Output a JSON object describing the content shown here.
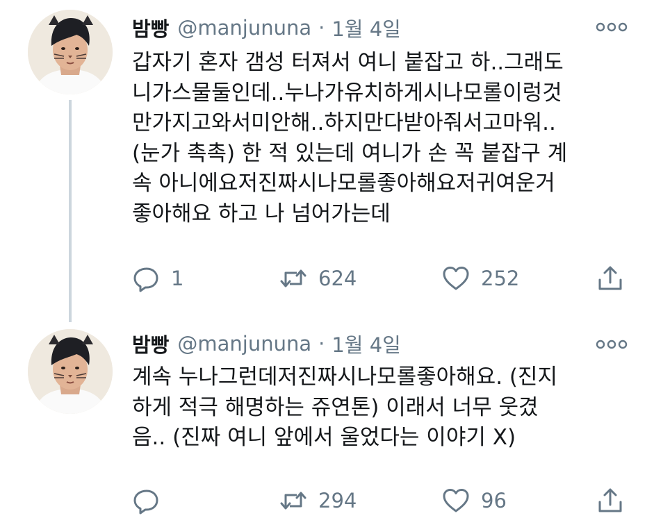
{
  "tweets": [
    {
      "display_name": "밤빵",
      "handle": "@manjununa",
      "separator": "·",
      "date": "1월 4일",
      "lines": [
        "갑자기 혼자 갬성 터져서 여니 붙잡고 하..그래도",
        "니가스물둘인데..누나가유치하게시나모롤이렁것",
        "만가지고와서미안해..하지만다받아줘서고마워..",
        "(눈가 촉촉) 한 적 있는데 여니가 손 꼭 붙잡구 계",
        "속 아니에요저진짜시나모롤좋아해요저귀여운거",
        "좋아해요 하고 나 넘어가는데"
      ],
      "reply_count": "1",
      "retweet_count": "624",
      "like_count": "252",
      "icons": {
        "avatar": "avatar-image",
        "more": "more-dots-icon",
        "reply": "reply-bubble-icon",
        "retweet": "retweet-icon",
        "like": "heart-icon",
        "share": "share-icon"
      }
    },
    {
      "display_name": "밤빵",
      "handle": "@manjununa",
      "separator": "·",
      "date": "1월 4일",
      "lines": [
        "계속 누나그런데저진짜시나모롤좋아해요. (진지",
        "하게 적극 해명하는 쥬연톤) 이래서 너무 웃겼",
        "음.. (진짜 여니 앞에서 울었다는 이야기 X)"
      ],
      "reply_count": "",
      "retweet_count": "294",
      "like_count": "96",
      "icons": {
        "avatar": "avatar-image",
        "more": "more-dots-icon",
        "reply": "reply-bubble-icon",
        "retweet": "retweet-icon",
        "like": "heart-icon",
        "share": "share-icon"
      }
    }
  ],
  "colors": {
    "text": "#14171a",
    "secondary": "#657786",
    "thread_line": "#ccd6dd",
    "background": "#ffffff"
  }
}
